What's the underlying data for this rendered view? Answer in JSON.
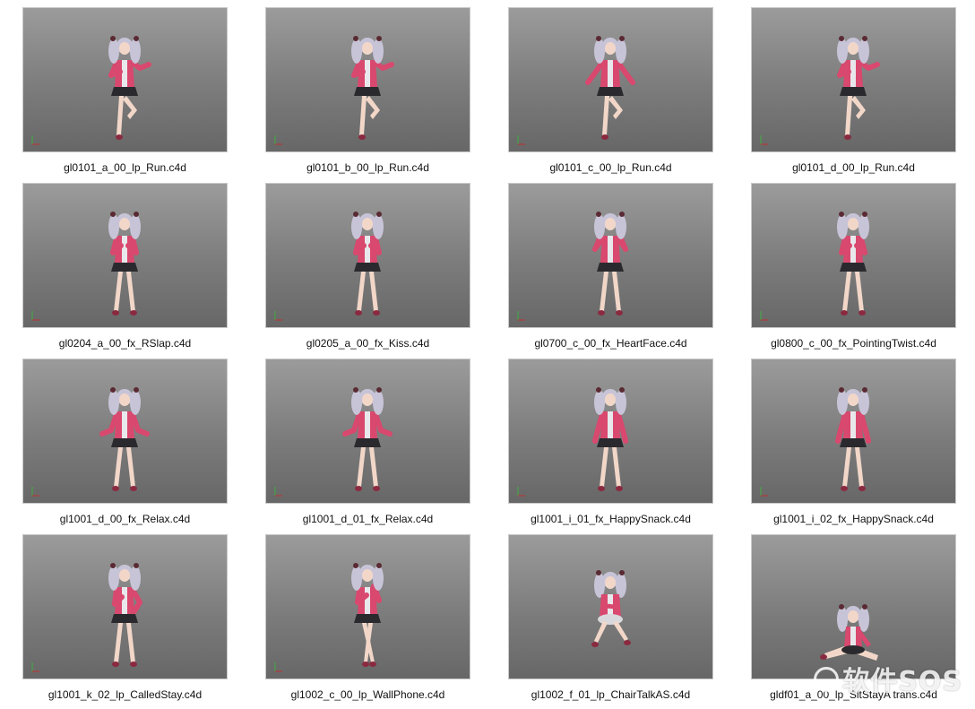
{
  "files": [
    {
      "name": "gl0101_a_00_lp_Run.c4d",
      "pose": "run-left"
    },
    {
      "name": "gl0101_b_00_lp_Run.c4d",
      "pose": "run-right"
    },
    {
      "name": "gl0101_c_00_lp_Run.c4d",
      "pose": "run-arms"
    },
    {
      "name": "gl0101_d_00_lp_Run.c4d",
      "pose": "run-left"
    },
    {
      "name": "gl0204_a_00_fx_RSlap.c4d",
      "pose": "stand-hands-chest"
    },
    {
      "name": "gl0205_a_00_fx_Kiss.c4d",
      "pose": "stand-hands-chest"
    },
    {
      "name": "gl0700_c_00_fx_HeartFace.c4d",
      "pose": "stand-hands-face"
    },
    {
      "name": "gl0800_c_00_fx_PointingTwist.c4d",
      "pose": "stand-hands-chest"
    },
    {
      "name": "gl1001_d_00_fx_Relax.c4d",
      "pose": "stand-arms-out"
    },
    {
      "name": "gl1001_d_01_fx_Relax.c4d",
      "pose": "stand-arms-out"
    },
    {
      "name": "gl1001_i_01_fx_HappySnack.c4d",
      "pose": "stand-arms-down"
    },
    {
      "name": "gl1001_i_02_fx_HappySnack.c4d",
      "pose": "stand-arms-down"
    },
    {
      "name": "gl1001_k_02_lp_CalledStay.c4d",
      "pose": "stand-hand-hip"
    },
    {
      "name": "gl1002_c_00_lp_WallPhone.c4d",
      "pose": "stand-cross-legs"
    },
    {
      "name": "gl1002_f_01_lp_ChairTalkAS.c4d",
      "pose": "sit-chair"
    },
    {
      "name": "gldf01_a_00_lp_SitStayA trans.c4d",
      "pose": "sit-floor"
    }
  ],
  "watermark": "软件SOS",
  "colors": {
    "jacket": "#d9486e",
    "hair": "#c8c4d8",
    "skirt": "#2a2a2e",
    "skin": "#f2d7c9"
  }
}
